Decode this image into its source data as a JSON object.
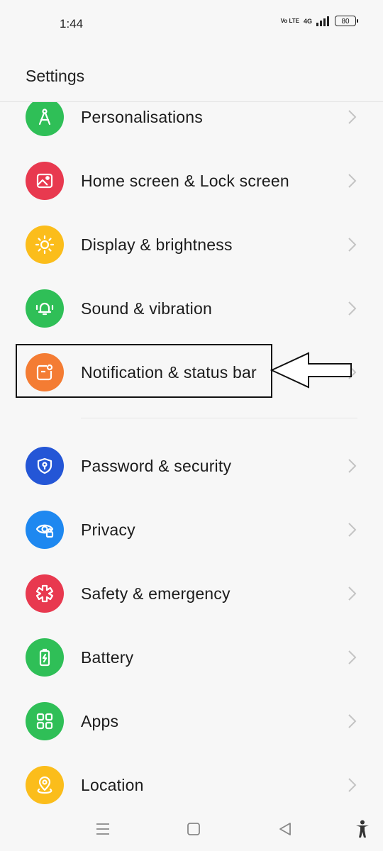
{
  "status_bar": {
    "time": "1:44",
    "volte": "Vo LTE",
    "network": "4G",
    "battery": "80"
  },
  "header": {
    "title": "Settings"
  },
  "items_top": [
    {
      "label": "Personalisations",
      "color": "#2fbf57",
      "icon": "compass-icon"
    },
    {
      "label": "Home screen & Lock screen",
      "color": "#e8394f",
      "icon": "picture-icon"
    },
    {
      "label": "Display & brightness",
      "color": "#fbbd1b",
      "icon": "sun-icon"
    },
    {
      "label": "Sound & vibration",
      "color": "#2fbf57",
      "icon": "bell-icon"
    },
    {
      "label": "Notification & status bar",
      "color": "#f47c33",
      "icon": "notification-icon"
    }
  ],
  "items_bottom": [
    {
      "label": "Password & security",
      "color": "#2456d6",
      "icon": "shield-key-icon"
    },
    {
      "label": "Privacy",
      "color": "#1e88f0",
      "icon": "eye-lock-icon"
    },
    {
      "label": "Safety & emergency",
      "color": "#e8394f",
      "icon": "asterisk-icon"
    },
    {
      "label": "Battery",
      "color": "#2fbf57",
      "icon": "battery-icon"
    },
    {
      "label": "Apps",
      "color": "#2fbf57",
      "icon": "apps-grid-icon"
    },
    {
      "label": "Location",
      "color": "#fbbd1b",
      "icon": "location-pin-icon"
    }
  ]
}
